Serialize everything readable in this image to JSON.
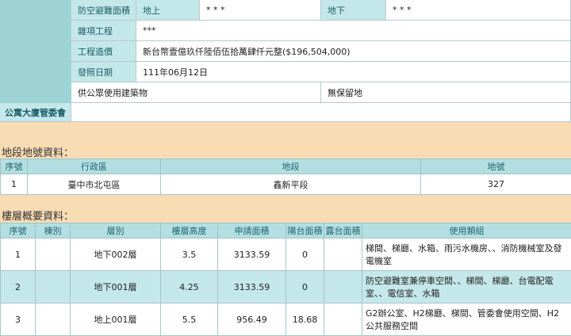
{
  "info": {
    "shelter": {
      "label": "防空避難面積",
      "above_label": "地上",
      "above_value": "* * *",
      "below_label": "地下",
      "below_value": "* * *"
    },
    "misc": {
      "label": "雜項工程",
      "value": "***"
    },
    "cost": {
      "label": "工程造價",
      "value": "新台幣壹億玖仟陸佰伍拾萬肆仟元整($196,504,000)"
    },
    "issue": {
      "label": "發照日期",
      "value": "111年06月12日"
    },
    "public_use": "供公眾使用建築物",
    "no_reserve": "無保留地",
    "committee_label": "公寓大廈管委會"
  },
  "land": {
    "title": "地段地號資料：",
    "headers": [
      "序號",
      "行政區",
      "地段",
      "地號"
    ],
    "rows": [
      [
        "1",
        "臺中市北屯區",
        "鑫新平段",
        "327"
      ]
    ]
  },
  "floors": {
    "title": "樓層概要資料：",
    "headers": [
      "序號",
      "棟別",
      "層別",
      "樓層高度",
      "申請面積",
      "陽台面積",
      "露台面積",
      "使用類組"
    ],
    "rows": [
      [
        "1",
        "",
        "地下002層",
        "3.5",
        "3133.59",
        "0",
        "",
        "梯間、梯廳、水箱、雨污水機房、、消防機械室及發電機室"
      ],
      [
        "2",
        "",
        "地下001層",
        "4.25",
        "3133.59",
        "0",
        "",
        "防空避難室兼停車空間、、梯間、梯廳、台電配電室、、電信室、水箱"
      ],
      [
        "3",
        "",
        "地上001層",
        "5.5",
        "956.49",
        "18.68",
        "",
        "G2辦公室、H2梯廳、梯間、管委會使用空間、H2公共服務空間"
      ]
    ]
  },
  "colors": {
    "background": "#f8dcb4",
    "label_bg": "#c4e7e9",
    "header_bg": "#b3dfe2",
    "left_bar": "#9ed3d5"
  }
}
